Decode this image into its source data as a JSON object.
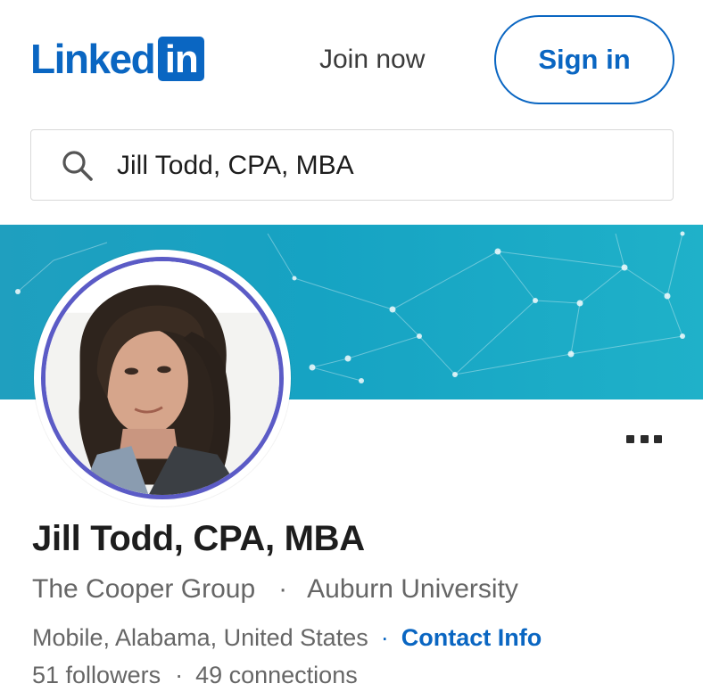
{
  "header": {
    "logo_word": "Linked",
    "logo_box": "in",
    "join_label": "Join now",
    "signin_label": "Sign in"
  },
  "search": {
    "value": "Jill Todd, CPA, MBA",
    "icon": "search-icon"
  },
  "profile": {
    "name": "Jill Todd, CPA, MBA",
    "company": "The Cooper Group",
    "education": "Auburn University",
    "location": "Mobile, Alabama, United States",
    "contact_label": "Contact Info",
    "followers": "51 followers",
    "connections": "49 connections",
    "separator": "·",
    "more_icon": "more-options-icon"
  },
  "colors": {
    "brand": "#0a66c2",
    "banner": "#16a3c3",
    "avatar_ring": "#5b5bc6",
    "muted_text": "#666666"
  }
}
